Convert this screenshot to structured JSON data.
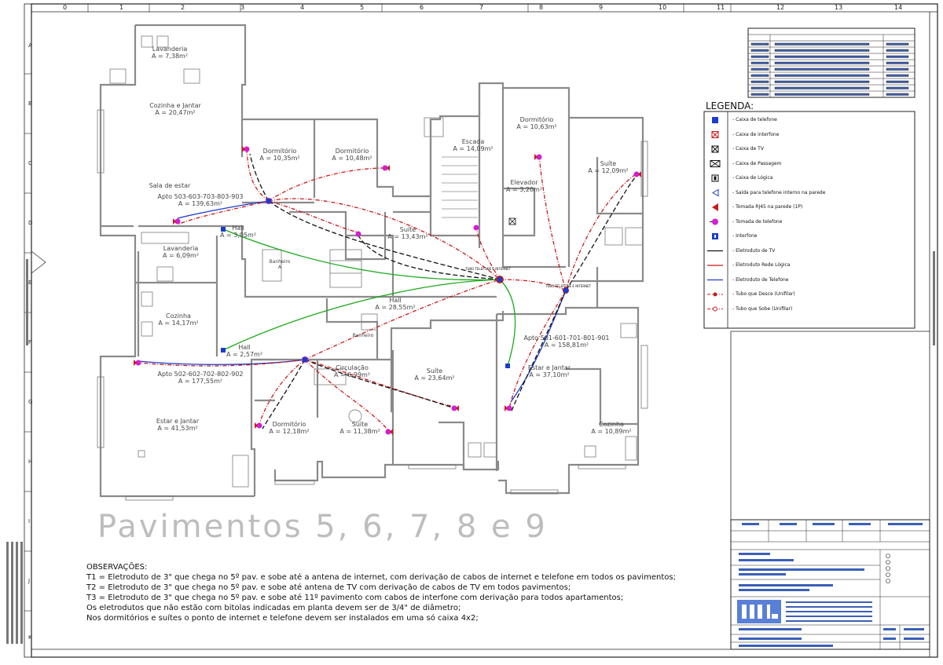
{
  "colors": {
    "telefone": "#1c3ccc",
    "rede": "#c81a1a",
    "tv": "#111111",
    "interfone": "#1aa81a",
    "tomada_telefone": "#d21fd2",
    "wall": "#888888"
  },
  "grid": {
    "columns": [
      "0",
      "1",
      "2",
      "3",
      "4",
      "5",
      "6",
      "7",
      "8",
      "9",
      "10",
      "11",
      "12",
      "13",
      "14"
    ],
    "rows": [
      "A",
      "B",
      "C",
      "D",
      "E",
      "F",
      "G",
      "H",
      "I",
      "J",
      "K"
    ]
  },
  "rooms": [
    {
      "name": "Lavanderia",
      "area": "A = 7,38m²"
    },
    {
      "name": "Cozinha e Jantar",
      "area": "A = 20,47m²"
    },
    {
      "name": "Sala de estar",
      "area": ""
    },
    {
      "name": "Apto 503-603-703-803-903",
      "area": "A = 139,63m²"
    },
    {
      "name": "Dormitório",
      "area": "A = 10,35m²"
    },
    {
      "name": "Dormitório",
      "area": "A = 10,48m²"
    },
    {
      "name": "Hall",
      "area": "A = 3,05m²"
    },
    {
      "name": "Lavanderia",
      "area": "A = 6,09m²"
    },
    {
      "name": "Cozinha",
      "area": "A = 14,17m²"
    },
    {
      "name": "Hall",
      "area": "A = 2,57m²"
    },
    {
      "name": "Apto 502-602-702-802-902",
      "area": "A = 177,55m²"
    },
    {
      "name": "Estar e Jantar",
      "area": "A = 41,53m²"
    },
    {
      "name": "Dormitório",
      "area": "A = 12,18m²"
    },
    {
      "name": "Circulação",
      "area": "A = 6,99m²"
    },
    {
      "name": "Suíte",
      "area": "A = 11,38m²"
    },
    {
      "name": "Suíte",
      "area": "A = 13,43m²"
    },
    {
      "name": "Hall",
      "area": "A = 28,55m²"
    },
    {
      "name": "Suíte",
      "area": "A = 23,64m²"
    },
    {
      "name": "Escada",
      "area": "A = 14,09m²"
    },
    {
      "name": "Elevador",
      "area": "A = 3,20m²"
    },
    {
      "name": "Dormitório",
      "area": "A = 10,63m²"
    },
    {
      "name": "Suíte",
      "area": "A = 12,09m²"
    },
    {
      "name": "Apto 501-601-701-801-901",
      "area": "A = 158,81m²"
    },
    {
      "name": "Estar e Jantar",
      "area": "A = 37,10m²"
    },
    {
      "name": "Cozinha",
      "area": "A = 10,89m²"
    },
    {
      "name": "Banheiro",
      "area": "A"
    },
    {
      "name": "Banheiro",
      "area": ""
    }
  ],
  "title_big": "Pavimentos 5, 6, 7, 8 e 9",
  "observacoes": {
    "title": "OBSERVAÇÕES:",
    "lines": [
      "T1 = Eletroduto de 3\" que chega no 5º pav. e sobe até a antena de internet, com derivação de cabos de internet e telefone em todos os pavimentos;",
      "T2 = Eletroduto de 3\" que chega no 5º pav. e sobe até antena de TV com derivação de cabos de TV em todos pavimentos;",
      "T3 = Eletroduto de 3\" que chega no 5º pav. e sobe até 11º pavimento com cabos de interfone com derivação para todos apartamentos;",
      "Os eletrodutos que não estão com bitolas indicadas em planta devem ser de 3/4\" de diâmetro;",
      "Nos dormitórios e suítes o ponto de internet e telefone devem ser instalados em uma só caixa 4x2;"
    ]
  },
  "legenda": {
    "title": "LEGENDA:",
    "items": [
      {
        "icon": "caixa-telefone-icon",
        "label": "- Caixa de telefone"
      },
      {
        "icon": "caixa-interfone-icon",
        "label": "- Caixa de interfone"
      },
      {
        "icon": "caixa-tv-icon",
        "label": "- Caixa de TV"
      },
      {
        "icon": "caixa-passagem-icon",
        "label": "- Caixa de Passagem"
      },
      {
        "icon": "caixa-logica-icon",
        "label": "- Caixa de Lógica"
      },
      {
        "icon": "saida-telefone-icon",
        "label": "- Saída para telefone interno na parede"
      },
      {
        "icon": "tomada-rj45-icon",
        "label": "- Tomada RJ45 na parede (1P)"
      },
      {
        "icon": "tomada-telefone-icon",
        "label": "- Tomada de telefone"
      },
      {
        "icon": "interfone-icon",
        "label": "- Interfone"
      },
      {
        "icon": "eletroduto-tv-icon",
        "label": "- Eletroduto de TV"
      },
      {
        "icon": "eletroduto-rede-icon",
        "label": "- Eletroduto Rede Lógica"
      },
      {
        "icon": "eletroduto-telefone-icon",
        "label": "- Eletroduto de Telefone"
      },
      {
        "icon": "tubo-desce-icon",
        "label": "- Tubo que Desce (Unifilar)"
      },
      {
        "icon": "tubo-sobe-icon",
        "label": "- Tubo que Sobe (Unifilar)"
      }
    ]
  },
  "riser_labels": [
    "TUBO TELEFONE E INTERNET",
    "TUBO TELEFONE E INTERNET"
  ]
}
